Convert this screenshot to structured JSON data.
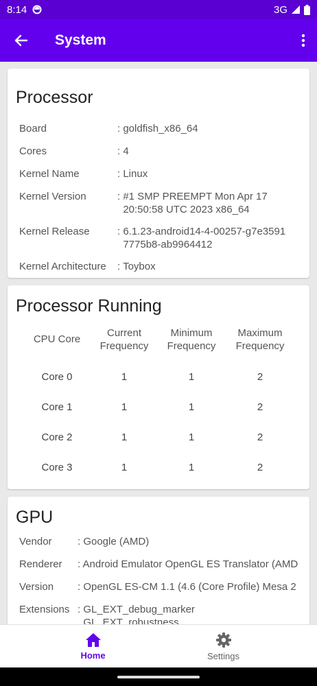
{
  "status_bar": {
    "time": "8:14",
    "network": "3G"
  },
  "app_bar": {
    "title": "System"
  },
  "processor": {
    "title": "Processor",
    "rows": [
      {
        "label": "Board",
        "value": ": goldfish_x86_64"
      },
      {
        "label": "Cores",
        "value": ": 4"
      },
      {
        "label": "Kernel Name",
        "value": ": Linux"
      },
      {
        "label": "Kernel Version",
        "value": ": #1 SMP PREEMPT Mon Apr 17\n  20:50:58 UTC 2023 x86_64"
      },
      {
        "label": "Kernel Release",
        "value": ": 6.1.23-android14-4-00257-g7e3591\n  7775b8-ab9964412"
      },
      {
        "label": "Kernel Architecture",
        "value": ": Toybox"
      }
    ]
  },
  "processor_running": {
    "title": "Processor Running",
    "headers": [
      "CPU Core",
      "Current\nFrequency",
      "Minimum\nFrequency",
      "Maximum\nFrequency"
    ],
    "rows": [
      [
        "Core 0",
        "1",
        "1",
        "2"
      ],
      [
        "Core 1",
        "1",
        "1",
        "2"
      ],
      [
        "Core 2",
        "1",
        "1",
        "2"
      ],
      [
        "Core 3",
        "1",
        "1",
        "2"
      ]
    ]
  },
  "gpu": {
    "title": "GPU",
    "rows": [
      {
        "label": "Vendor",
        "value": ": Google (AMD)"
      },
      {
        "label": "Renderer",
        "value": ": Android Emulator OpenGL ES Translator (AMD"
      },
      {
        "label": "Version",
        "value": ": OpenGL ES-CM 1.1 (4.6 (Core Profile) Mesa 2"
      },
      {
        "label": "Extensions",
        "value": ": GL_EXT_debug_marker\n  GL_EXT_robustness"
      }
    ]
  },
  "bottom_nav": {
    "items": [
      {
        "label": "Home",
        "icon": "home-icon",
        "active": true
      },
      {
        "label": "Settings",
        "icon": "gear-icon",
        "active": false
      }
    ]
  },
  "colors": {
    "primary": "#6200ee",
    "status_bar": "#5a00d2"
  }
}
